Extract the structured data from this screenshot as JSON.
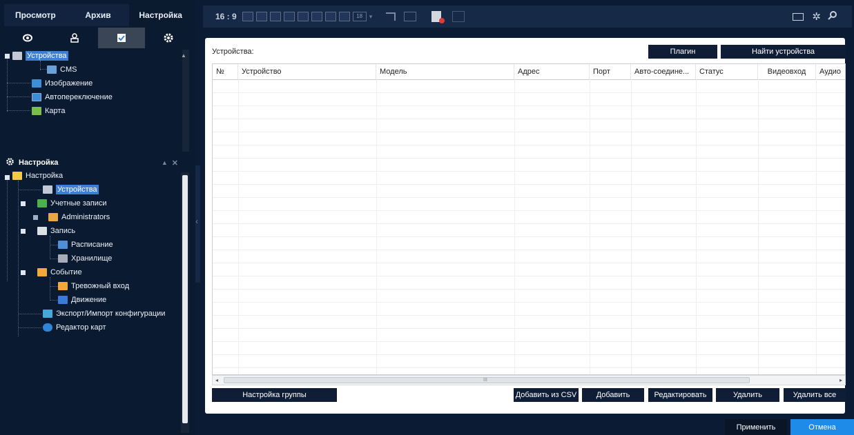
{
  "nav": {
    "tabs": [
      {
        "label": "Просмотр"
      },
      {
        "label": "Архив"
      },
      {
        "label": "Настройка"
      }
    ]
  },
  "devices_tree": {
    "items": [
      {
        "label": "Устройства"
      },
      {
        "label": "CMS"
      },
      {
        "label": "Изображение"
      },
      {
        "label": "Автопереключение"
      },
      {
        "label": "Карта"
      }
    ]
  },
  "settings_panel": {
    "title": "Настройка",
    "items": [
      {
        "label": "Настройка"
      },
      {
        "label": "Устройства"
      },
      {
        "label": "Учетные записи"
      },
      {
        "label": "Administrators"
      },
      {
        "label": "Запись"
      },
      {
        "label": "Расписание"
      },
      {
        "label": "Хранилище"
      },
      {
        "label": "Событие"
      },
      {
        "label": "Тревожный вход"
      },
      {
        "label": "Движение"
      },
      {
        "label": "Экспорт/Импорт конфигурации"
      },
      {
        "label": "Редактор карт"
      }
    ]
  },
  "toolbar": {
    "ratio": "16 : 9",
    "split_count": "18"
  },
  "main": {
    "title": "Устройства:",
    "plugin_button": "Плагин",
    "find_button": "Найти устройства",
    "columns": [
      "№",
      "Устройство",
      "Модель",
      "Адрес",
      "Порт",
      "Авто-соедине...",
      "Статус",
      "Видеовход",
      "Аудио"
    ],
    "scroll_marker": "III",
    "group_button": "Настройка группы",
    "csv_button": "Добавить из CSV",
    "add_button": "Добавить",
    "edit_button": "Редактировать",
    "delete_button": "Удалить",
    "delete_all_button": "Удалить все"
  },
  "footer": {
    "apply_button": "Применить",
    "cancel_button": "Отмена"
  },
  "colors": {
    "accent": "#3c7fd6",
    "cancel": "#1f8be8",
    "panel": "#0a1a31"
  }
}
